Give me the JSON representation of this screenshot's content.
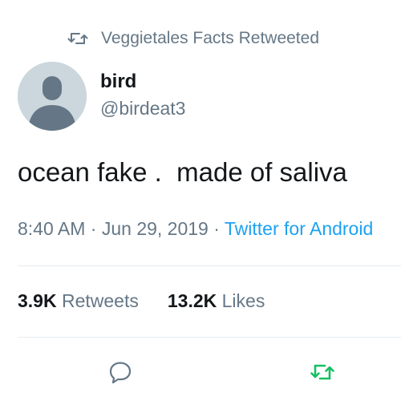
{
  "retweet_context": {
    "text": "Veggietales Facts Retweeted",
    "icon": "retweet-icon"
  },
  "author": {
    "name": "bird",
    "handle": "@birdeat3",
    "avatar": "default-avatar"
  },
  "tweet": {
    "text": "ocean fake .  made of saliva"
  },
  "meta": {
    "time": "8:40 AM",
    "sep1": " · ",
    "date": "Jun 29, 2019",
    "sep2": " · ",
    "source": "Twitter for Android"
  },
  "stats": {
    "retweets_count": "3.9K",
    "retweets_label": "Retweets",
    "likes_count": "13.2K",
    "likes_label": "Likes"
  },
  "actions": {
    "reply_icon": "reply-icon",
    "retweet_icon": "retweet-icon",
    "retweet_active_color": "#17bf63"
  },
  "colors": {
    "secondary_text": "#657786",
    "primary_text": "#14171a",
    "link": "#1da1f2",
    "divider": "#e6ecf0"
  }
}
